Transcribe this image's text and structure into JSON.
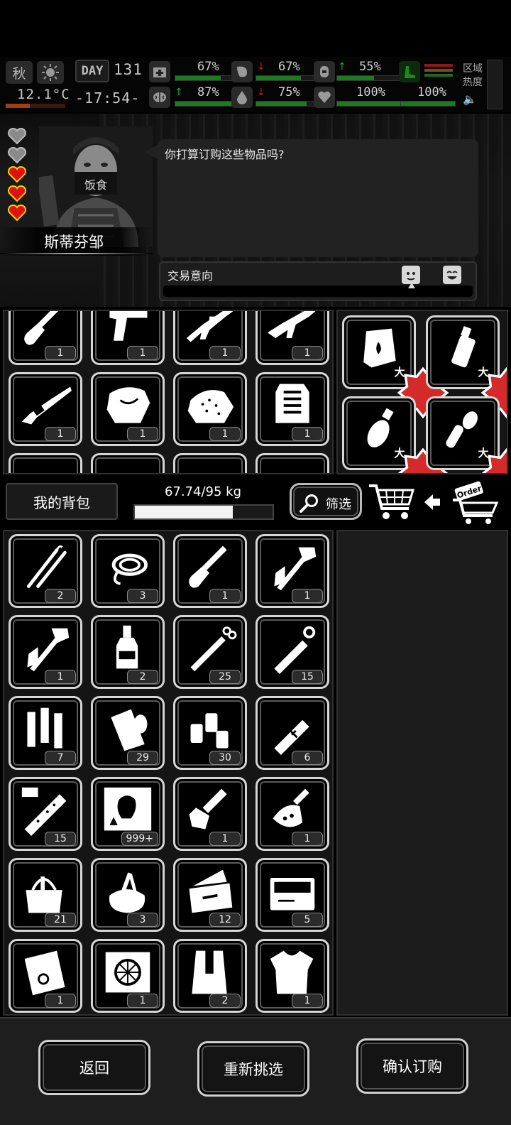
{
  "hud": {
    "season": "秋",
    "temperature": "12.1°C",
    "day_label": "DAY",
    "day_number": "131",
    "clock": "-17:54-",
    "stats": {
      "health": "67%",
      "food": "67%",
      "stamina": "55%",
      "mood": "87%",
      "water": "75%",
      "heart": "100%",
      "sanity": "100%"
    },
    "stat_levels": {
      "health": 0.67,
      "food": 0.67,
      "stamina": 0.55,
      "mood": 0.87,
      "water": 0.75,
      "heart": 1.0,
      "sanity": 1.0
    },
    "zone_heat_label": "区域热度"
  },
  "npc": {
    "name": "斯蒂芬邹",
    "mask_text": "饭食",
    "dialog": "你打算订购这些物品吗?",
    "affection_hearts": [
      false,
      false,
      true,
      true,
      true
    ],
    "trade_intent_label": "交易意向",
    "trade_intent_level": 0.8
  },
  "shop_items": [
    {
      "icon": "shovel-icon",
      "count": "1"
    },
    {
      "icon": "pistol-icon",
      "count": "1"
    },
    {
      "icon": "rifle-icon",
      "count": "1"
    },
    {
      "icon": "assault-rifle-icon",
      "count": "1"
    },
    {
      "icon": "shotgun-icon",
      "count": "1"
    },
    {
      "icon": "cloth-armor-icon",
      "count": "1"
    },
    {
      "icon": "padded-armor-icon",
      "count": "1"
    },
    {
      "icon": "vest-armor-icon",
      "count": "1"
    }
  ],
  "order_items": [
    {
      "icon": "molotov-pack-icon",
      "badge": "大"
    },
    {
      "icon": "smoke-grenade-icon",
      "badge": "大"
    },
    {
      "icon": "frag-grenade-icon",
      "badge": "大"
    },
    {
      "icon": "stick-grenade-icon",
      "badge": "大"
    }
  ],
  "backpack": {
    "label": "我的背包",
    "weight": "67.74/95 kg",
    "weight_fraction": 0.713,
    "filter_label": "筛选",
    "order_tag": "Order",
    "items": [
      {
        "icon": "lockpick-icon",
        "count": "2"
      },
      {
        "icon": "rope-icon",
        "count": "3"
      },
      {
        "icon": "shovel-icon",
        "count": "1"
      },
      {
        "icon": "axe-icon",
        "count": "1"
      },
      {
        "icon": "axe-icon",
        "count": "1"
      },
      {
        "icon": "bottle-icon",
        "count": "2"
      },
      {
        "icon": "syringe-icon",
        "count": "25"
      },
      {
        "icon": "injector-icon",
        "count": "15"
      },
      {
        "icon": "batteries-icon",
        "count": "7"
      },
      {
        "icon": "bandage-roll-icon",
        "count": "29"
      },
      {
        "icon": "pill-bottles-icon",
        "count": "30"
      },
      {
        "icon": "medkit-syringe-icon",
        "count": "6"
      },
      {
        "icon": "vaccine-tube-icon",
        "count": "15"
      },
      {
        "icon": "zombie-card-icon",
        "count": "999+"
      },
      {
        "icon": "key-icon",
        "count": "1"
      },
      {
        "icon": "car-key-icon",
        "count": "1"
      },
      {
        "icon": "tool-bag-icon",
        "count": "21"
      },
      {
        "icon": "tool-sack-icon",
        "count": "3"
      },
      {
        "icon": "toolbox-icon",
        "count": "12"
      },
      {
        "icon": "tool-case-icon",
        "count": "5"
      },
      {
        "icon": "blueprint-icon",
        "count": "1"
      },
      {
        "icon": "wheel-blueprint-icon",
        "count": "1"
      },
      {
        "icon": "vest-icon",
        "count": "2"
      },
      {
        "icon": "body-armor-icon",
        "count": "1"
      }
    ]
  },
  "buttons": {
    "back": "返回",
    "reselect": "重新挑选",
    "confirm": "确认订购"
  },
  "colors": {
    "stat_green": "#1e7a1e",
    "arrow_up": "#18b018",
    "arrow_down": "#c81818",
    "heart_red": "#e01010",
    "badge_red": "#d42a2a"
  }
}
